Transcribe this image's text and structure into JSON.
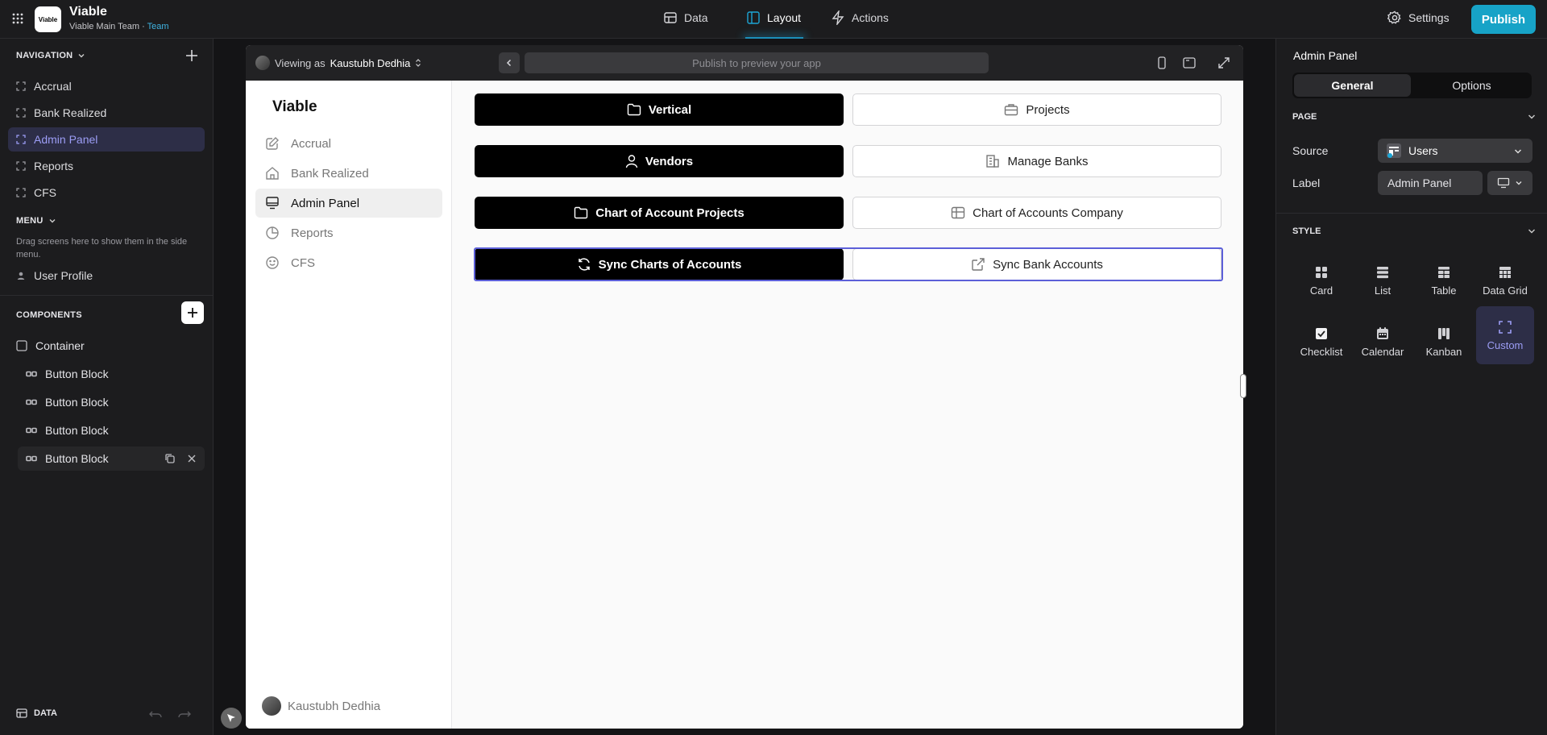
{
  "topbar": {
    "app_logo_text": "Viable",
    "app_name": "Viable",
    "team_name": "Viable Main Team",
    "team_separator": "·",
    "team_label": "Team",
    "tabs": [
      {
        "label": "Data",
        "icon": "table-icon"
      },
      {
        "label": "Layout",
        "icon": "layout-icon"
      },
      {
        "label": "Actions",
        "icon": "bolt-icon"
      }
    ],
    "active_tab": "Layout",
    "settings_label": "Settings",
    "publish_label": "Publish",
    "accent": "#17a3c7"
  },
  "leftbar": {
    "navigation_header": "NAVIGATION",
    "nav_items": [
      {
        "label": "Accrual",
        "active": false
      },
      {
        "label": "Bank Realized",
        "active": false
      },
      {
        "label": "Admin Panel",
        "active": true
      },
      {
        "label": "Reports",
        "active": false
      },
      {
        "label": "CFS",
        "active": false
      }
    ],
    "menu_header": "MENU",
    "menu_hint": "Drag screens here to show them in the side menu.",
    "menu_items": [
      {
        "label": "User Profile"
      }
    ],
    "components_header": "COMPONENTS",
    "components": [
      {
        "label": "Container"
      },
      {
        "label": "Button Block"
      },
      {
        "label": "Button Block"
      },
      {
        "label": "Button Block"
      },
      {
        "label": "Button Block"
      }
    ],
    "footer_label": "DATA"
  },
  "preview": {
    "viewing_prefix": "Viewing as",
    "viewing_user": "Kaustubh Dedhia",
    "url_placeholder": "Publish to preview your app",
    "app_logo": "Viable",
    "app_nav": [
      {
        "label": "Accrual",
        "icon": "edit-icon",
        "active": false
      },
      {
        "label": "Bank Realized",
        "icon": "home-icon",
        "active": false
      },
      {
        "label": "Admin Panel",
        "icon": "monitor-icon",
        "active": true
      },
      {
        "label": "Reports",
        "icon": "pie-icon",
        "active": false
      },
      {
        "label": "CFS",
        "icon": "smile-icon",
        "active": false
      }
    ],
    "buttons": [
      {
        "label": "Vertical",
        "style": "dark",
        "icon": "folder-icon"
      },
      {
        "label": "Projects",
        "style": "light",
        "icon": "briefcase-icon"
      },
      {
        "label": "Vendors",
        "style": "dark",
        "icon": "user-icon"
      },
      {
        "label": "Manage Banks",
        "style": "light",
        "icon": "building-icon"
      },
      {
        "label": "Chart of Account Projects",
        "style": "dark",
        "icon": "folder-icon"
      },
      {
        "label": "Chart of Accounts Company",
        "style": "light",
        "icon": "table-icon"
      },
      {
        "label": "Sync Charts of Accounts",
        "style": "dark",
        "icon": "refresh-icon"
      },
      {
        "label": "Sync Bank Accounts",
        "style": "light",
        "icon": "external-link-icon"
      }
    ],
    "user_name": "Kaustubh Dedhia"
  },
  "rightbar": {
    "title": "Admin Panel",
    "tabs": [
      {
        "label": "General",
        "active": true
      },
      {
        "label": "Options",
        "active": false
      }
    ],
    "page_header": "PAGE",
    "source_label": "Source",
    "source_value": "Users",
    "label_label": "Label",
    "label_value": "Admin Panel",
    "style_header": "STYLE",
    "styles": [
      {
        "label": "Card",
        "icon": "card-icon",
        "active": false
      },
      {
        "label": "List",
        "icon": "list-icon",
        "active": false
      },
      {
        "label": "Table",
        "icon": "table-icon",
        "active": false
      },
      {
        "label": "Data Grid",
        "icon": "data-grid-icon",
        "active": false
      },
      {
        "label": "Checklist",
        "icon": "checklist-icon",
        "active": false
      },
      {
        "label": "Calendar",
        "icon": "calendar-icon",
        "active": false
      },
      {
        "label": "Kanban",
        "icon": "kanban-icon",
        "active": false
      },
      {
        "label": "Custom",
        "icon": "custom-icon",
        "active": true
      }
    ]
  }
}
